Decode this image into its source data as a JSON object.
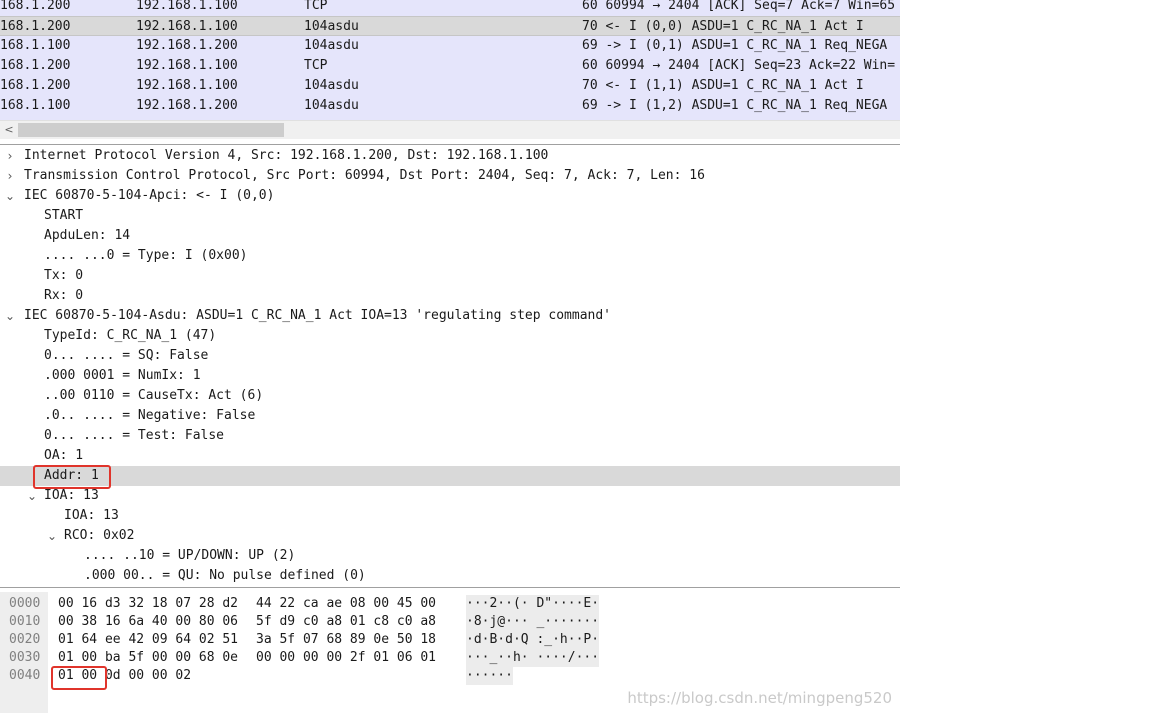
{
  "packet_list": {
    "rows": [
      {
        "source": "168.1.200",
        "destination": "192.168.1.100",
        "protocol": "TCP",
        "info": "60 60994 → 2404 [ACK] Seq=7 Ack=7 Win=65"
      },
      {
        "source": "168.1.200",
        "destination": "192.168.1.100",
        "protocol": "104asdu",
        "info": "70 <- I (0,0) ASDU=1 C_RC_NA_1 Act     I"
      },
      {
        "source": "168.1.100",
        "destination": "192.168.1.200",
        "protocol": "104asdu",
        "info": "69 -> I (0,1) ASDU=1 C_RC_NA_1 Req_NEGA"
      },
      {
        "source": "168.1.200",
        "destination": "192.168.1.100",
        "protocol": "TCP",
        "info": "60 60994 → 2404 [ACK] Seq=23 Ack=22 Win="
      },
      {
        "source": "168.1.200",
        "destination": "192.168.1.100",
        "protocol": "104asdu",
        "info": "70 <- I (1,1) ASDU=1 C_RC_NA_1 Act     I"
      },
      {
        "source": "168.1.100",
        "destination": "192.168.1.200",
        "protocol": "104asdu",
        "info": "69 -> I (1,2) ASDU=1 C_RC_NA_1 Req_NEGA"
      }
    ]
  },
  "scrollbar": {
    "left_arrow": "<"
  },
  "details": {
    "rows": [
      {
        "text": "Internet Protocol Version 4, Src: 192.168.1.200, Dst: 192.168.1.100",
        "toggle": ">"
      },
      {
        "text": "Transmission Control Protocol, Src Port: 60994, Dst Port: 2404, Seq: 7, Ack: 7, Len: 16",
        "toggle": ">"
      },
      {
        "text": "IEC 60870-5-104-Apci: <- I (0,0)",
        "toggle": "v"
      },
      {
        "text": "START",
        "toggle": ""
      },
      {
        "text": "ApduLen: 14",
        "toggle": ""
      },
      {
        "text": ".... ...0 = Type: I (0x00)",
        "toggle": ""
      },
      {
        "text": "Tx: 0",
        "toggle": ""
      },
      {
        "text": "Rx: 0",
        "toggle": ""
      },
      {
        "text": "IEC 60870-5-104-Asdu: ASDU=1 C_RC_NA_1 Act     IOA=13 'regulating step command'",
        "toggle": "v"
      },
      {
        "text": "TypeId: C_RC_NA_1 (47)",
        "toggle": ""
      },
      {
        "text": "0... .... = SQ: False",
        "toggle": ""
      },
      {
        "text": ".000 0001 = NumIx: 1",
        "toggle": ""
      },
      {
        "text": "..00 0110 = CauseTx: Act (6)",
        "toggle": ""
      },
      {
        "text": ".0.. .... = Negative: False",
        "toggle": ""
      },
      {
        "text": "0... .... = Test: False",
        "toggle": ""
      },
      {
        "text": "OA: 1",
        "toggle": ""
      },
      {
        "text": "Addr: 1",
        "toggle": ""
      },
      {
        "text": "IOA: 13",
        "toggle": "v"
      },
      {
        "text": "IOA: 13",
        "toggle": ""
      },
      {
        "text": "RCO: 0x02",
        "toggle": "v"
      },
      {
        "text": ".... ..10 = UP/DOWN: UP (2)",
        "toggle": ""
      },
      {
        "text": ".000 00.. = QU: No pulse defined (0)",
        "toggle": ""
      }
    ]
  },
  "bytes": {
    "rows": [
      {
        "offset": "0000",
        "hex1": "00 16 d3 32 18 07 28 d2",
        "hex2": "44 22 ca ae 08 00 45 00",
        "ascii": "···2··(· D\"····E·"
      },
      {
        "offset": "0010",
        "hex1": "00 38 16 6a 40 00 80 06",
        "hex2": "5f d9 c0 a8 01 c8 c0 a8",
        "ascii": "·8·j@··· _·······"
      },
      {
        "offset": "0020",
        "hex1": "01 64 ee 42 09 64 02 51",
        "hex2": "3a 5f 07 68 89 0e 50 18",
        "ascii": "·d·B·d·Q :_·h··P·"
      },
      {
        "offset": "0030",
        "hex1": "01 00 ba 5f 00 00 68 0e",
        "hex2": "00 00 00 00 2f 01 06 01",
        "ascii": "···_··h· ····/···"
      },
      {
        "offset": "0040",
        "hex1": "01 00 0d 00 00 02",
        "hex2": "",
        "ascii": "······"
      }
    ]
  },
  "watermark": "https://blog.csdn.net/mingpeng520",
  "colors": {
    "packet_bg": "#e5e5fb",
    "selected_bg": "#d9d9d9",
    "highlight_box": "#e0342b"
  }
}
